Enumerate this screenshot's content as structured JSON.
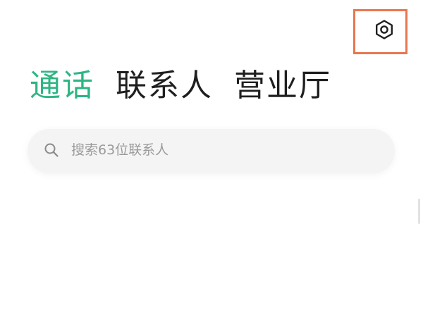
{
  "header": {
    "settings_icon": "hexagon-settings-icon",
    "highlight_color": "#E8774F"
  },
  "tabs": [
    {
      "label": "通话",
      "active": true
    },
    {
      "label": "联系人",
      "active": false
    },
    {
      "label": "营业厅",
      "active": false
    }
  ],
  "search": {
    "placeholder": "搜索63位联系人",
    "value": ""
  },
  "colors": {
    "accent": "#2DB584",
    "text": "#1f1f1f",
    "placeholder": "#9a9a9a",
    "search_bg": "#f4f4f4"
  }
}
